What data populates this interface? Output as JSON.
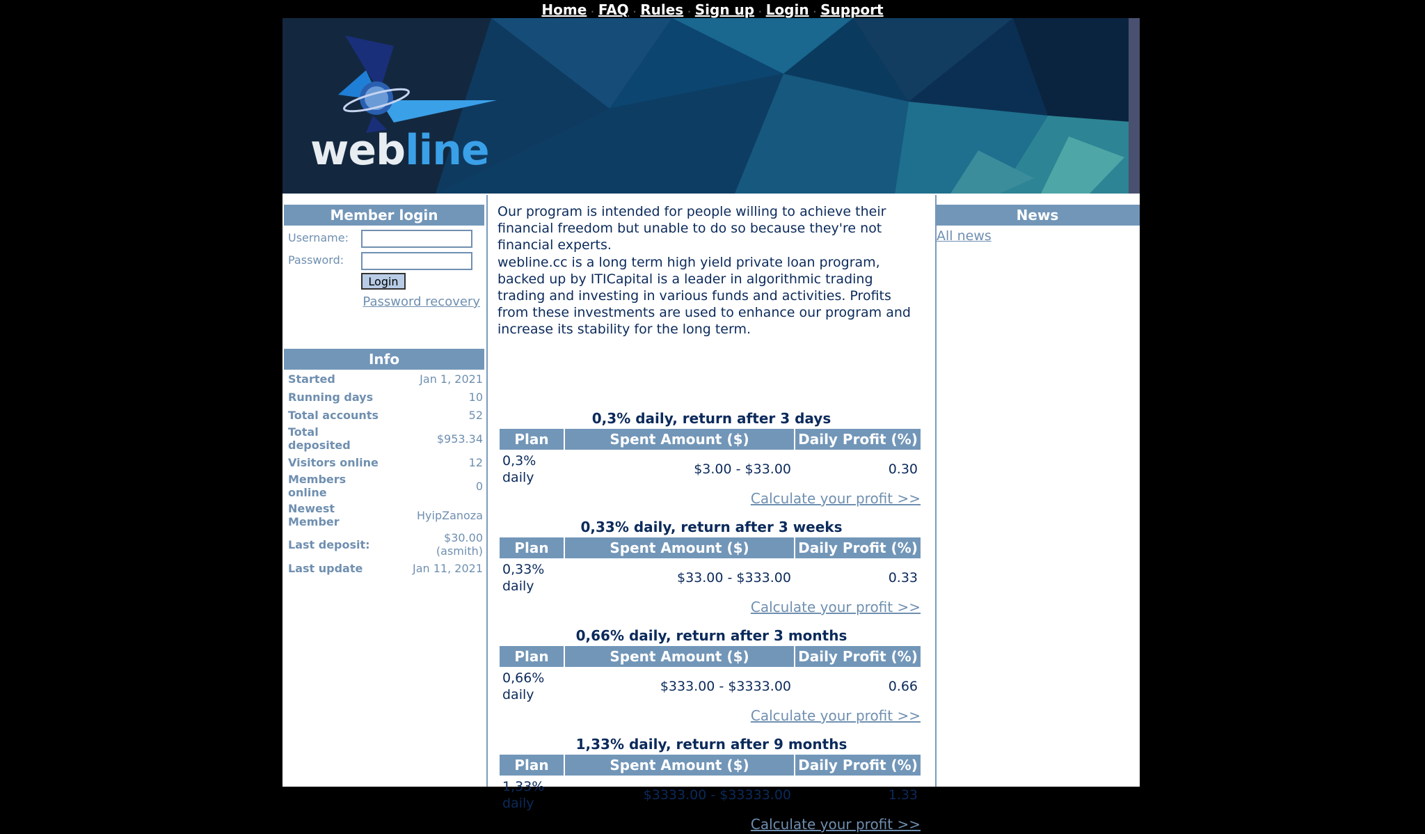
{
  "nav": {
    "items": [
      "Home",
      "FAQ",
      "Rules",
      "Sign up",
      "Login",
      "Support"
    ],
    "separator": "·"
  },
  "brand": {
    "logo_part1": "web",
    "logo_part2": "line"
  },
  "login": {
    "title": "Member login",
    "username_label": "Username:",
    "password_label": "Password:",
    "button": "Login",
    "recovery": "Password recovery"
  },
  "info": {
    "title": "Info",
    "rows": [
      {
        "k": "Started",
        "v": "Jan 1, 2021"
      },
      {
        "k": "Running days",
        "v": "10"
      },
      {
        "k": "Total accounts",
        "v": "52"
      },
      {
        "k": "Total deposited",
        "v": "$953.34"
      },
      {
        "k": "Visitors online",
        "v": "12"
      },
      {
        "k": "Members online",
        "v": "0"
      },
      {
        "k": "Newest Member",
        "v": "HyipZanoza"
      },
      {
        "k": "Last deposit:",
        "v": "$30.00 (asmith)"
      },
      {
        "k": "Last update",
        "v": "Jan 11, 2021"
      }
    ]
  },
  "intro": {
    "p1": "Our program is intended for people willing to achieve their financial freedom but unable to do so because they're not financial experts.",
    "p2": "webline.cc is a long term high yield private loan program, backed up by ITICapital is a leader in algorithmic trading trading and investing in various funds and activities. Profits from these investments are used to enhance our program and increase its stability for the long term."
  },
  "plans": {
    "headers": {
      "plan": "Plan",
      "spent": "Spent Amount ($)",
      "profit": "Daily Profit (%)"
    },
    "calc_label": "Calculate your profit >>",
    "items": [
      {
        "title": "0,3% daily, return after 3 days",
        "name": "0,3% daily",
        "range": "$3.00 - $33.00",
        "profit": "0.30"
      },
      {
        "title": "0,33% daily, return after 3 weeks",
        "name": "0,33% daily",
        "range": "$33.00 - $333.00",
        "profit": "0.33"
      },
      {
        "title": "0,66% daily, return after 3 months",
        "name": "0,66% daily",
        "range": "$333.00 - $3333.00",
        "profit": "0.66"
      },
      {
        "title": "1,33% daily, return after 9 months",
        "name": "1,33% daily",
        "range": "$3333.00 - $33333.00",
        "profit": "1.33"
      }
    ]
  },
  "news": {
    "title": "News",
    "all_link": "All news"
  }
}
